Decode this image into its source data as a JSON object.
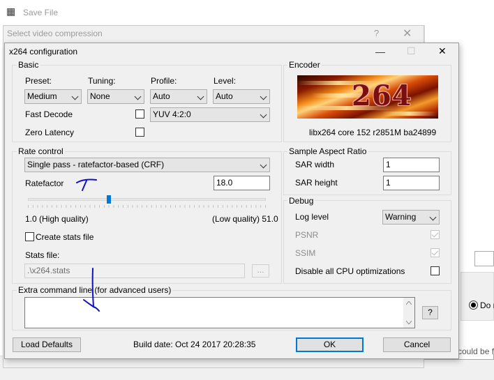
{
  "background_window": {
    "title": "Save File",
    "radio_text": "Do n",
    "partial_text": "could be fo"
  },
  "compression_window": {
    "title": "Select video compression",
    "help_glyph": "?",
    "close_glyph": "✕"
  },
  "dialog": {
    "title": "x264 configuration",
    "minimize_glyph": "—",
    "maximize_glyph": "☐",
    "close_glyph": "✕",
    "basic": {
      "group_label": "Basic",
      "preset_label": "Preset:",
      "preset_value": "Medium",
      "tuning_label": "Tuning:",
      "tuning_value": "None",
      "profile_label": "Profile:",
      "profile_value": "Auto",
      "level_label": "Level:",
      "level_value": "Auto",
      "fast_decode_label": "Fast Decode",
      "fast_decode_checked": false,
      "zero_latency_label": "Zero Latency",
      "zero_latency_checked": false,
      "colorspace_value": "YUV 4:2:0"
    },
    "encoder": {
      "group_label": "Encoder",
      "logo_text": "264",
      "version": "libx264 core 152 r2851M ba24899"
    },
    "rate_control": {
      "group_label": "Rate control",
      "mode_value": "Single pass - ratefactor-based (CRF)",
      "ratefactor_label": "Ratefactor",
      "ratefactor_value": "18.0",
      "slider_min_label": "1.0 (High quality)",
      "slider_max_label": "(Low quality) 51.0",
      "slider_min": 1.0,
      "slider_max": 51.0,
      "slider_value": 18.0,
      "create_stats_label": "Create stats file",
      "create_stats_checked": false,
      "stats_file_label": "Stats file:",
      "stats_file_value": ".\\x264.stats",
      "browse_label": "..."
    },
    "sar": {
      "group_label": "Sample Aspect Ratio",
      "width_label": "SAR width",
      "width_value": "1",
      "height_label": "SAR height",
      "height_value": "1"
    },
    "debug": {
      "group_label": "Debug",
      "log_level_label": "Log level",
      "log_level_value": "Warning",
      "psnr_label": "PSNR",
      "ssim_label": "SSIM",
      "disable_cpu_label": "Disable all CPU optimizations",
      "disable_cpu_checked": false
    },
    "extra": {
      "group_label": "Extra command line (for advanced users)",
      "value": "",
      "help_label": "?"
    },
    "footer": {
      "load_defaults_label": "Load Defaults",
      "build_date": "Build date: Oct 24 2017 20:28:35",
      "ok_label": "OK",
      "cancel_label": "Cancel"
    }
  },
  "colors": {
    "accent": "#0078d7",
    "ink_annotation": "#1010c8",
    "dialog_bg": "#f0f0f0"
  }
}
